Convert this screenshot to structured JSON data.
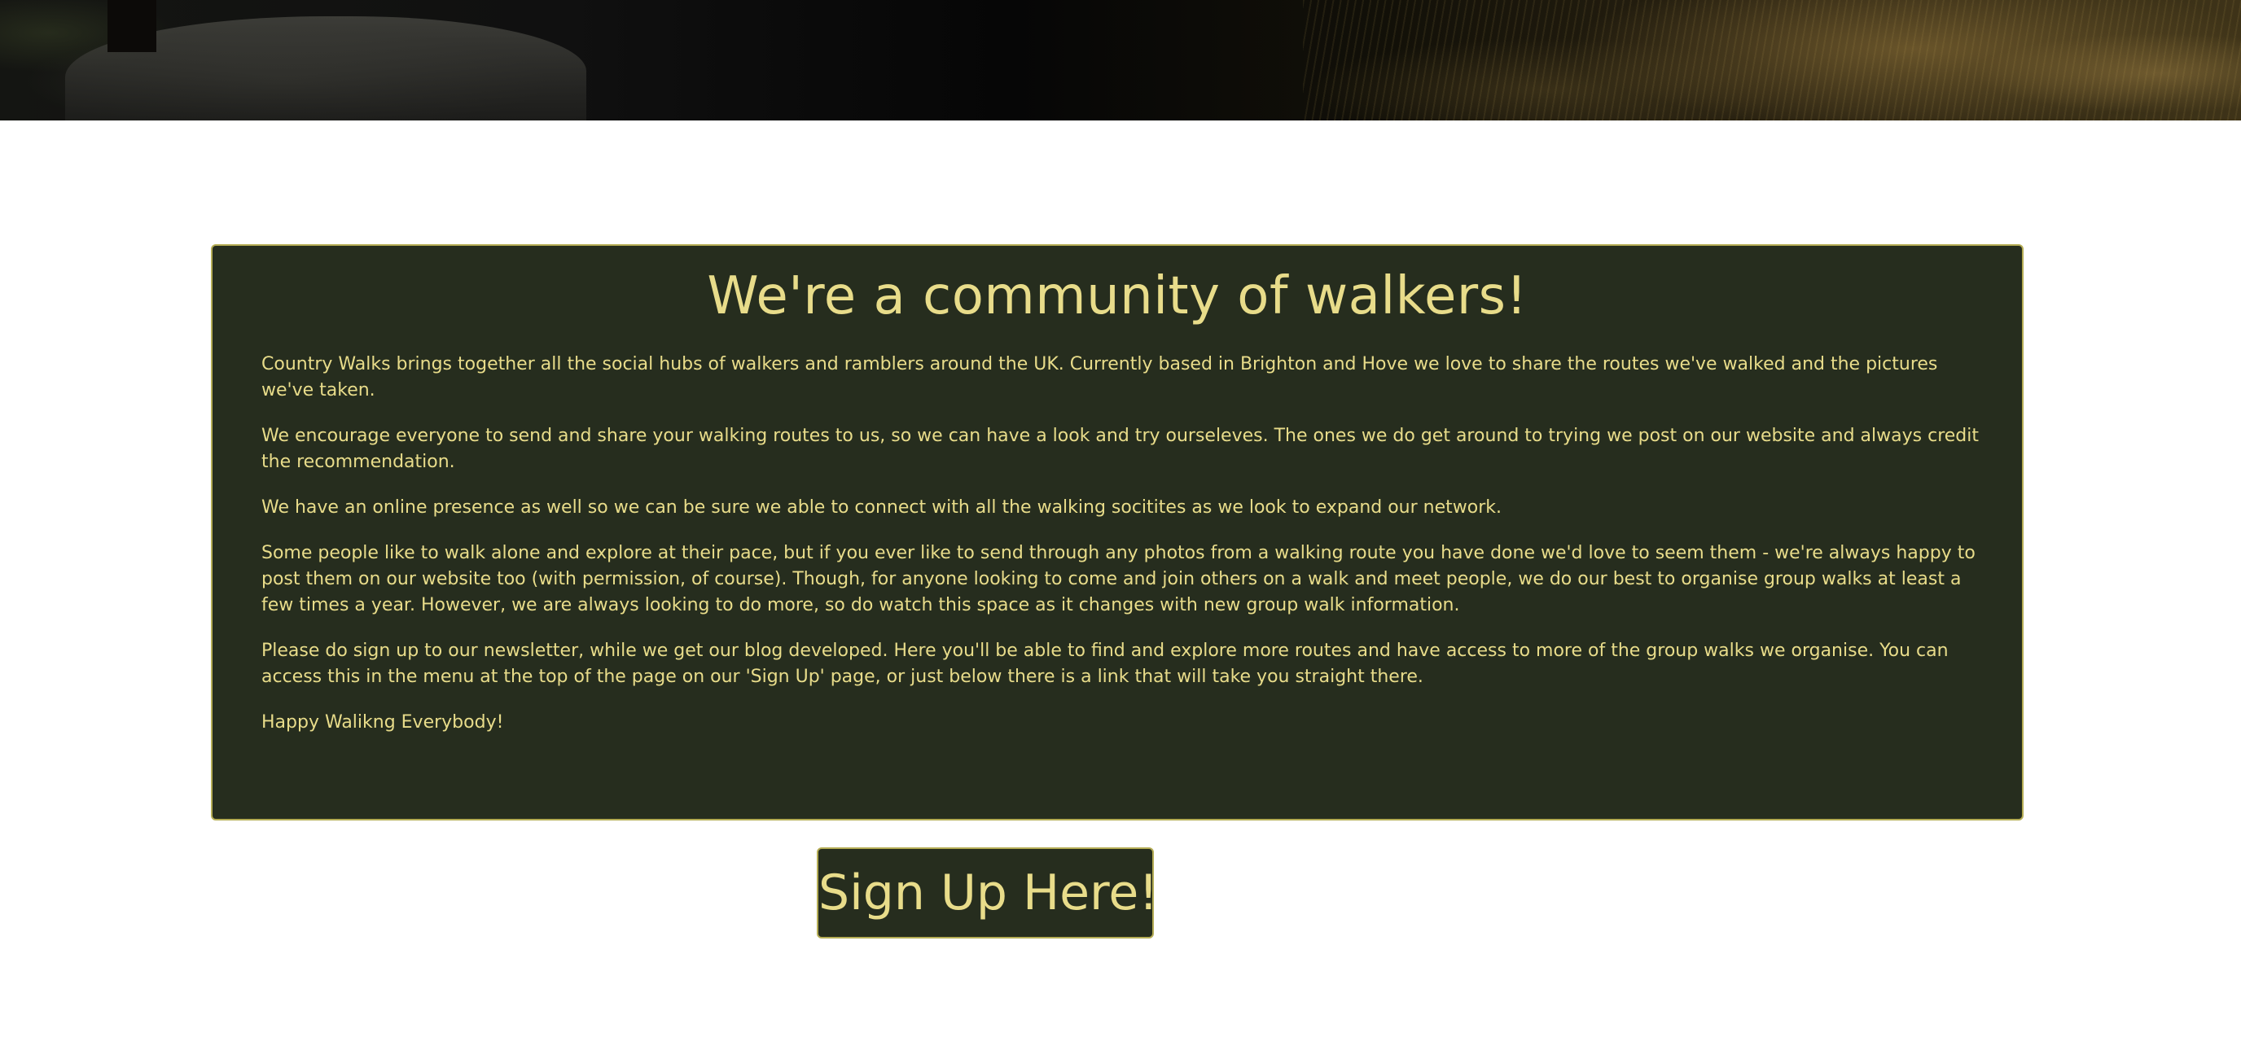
{
  "about": {
    "heading": "We're a community of walkers!",
    "paragraphs": [
      "Country Walks brings together all the social hubs of walkers and ramblers around the UK. Currently based in Brighton and Hove we love to share the routes we've walked and the pictures we've taken.",
      "We encourage everyone to send and share your walking routes to us, so we can have a look and try ourseleves. The ones we do get around to trying we post on our website and always credit the recommendation.",
      "We have an online presence as well so we can be sure we able to connect with all the walking socitites as we look to expand our network.",
      "Some people like to walk alone and explore at their pace, but if you ever like to send through any photos from a walking route you have done we'd love to seem them - we're always happy to post them on our website too (with permission, of course). Though, for anyone looking to come and join others on a walk and meet people, we do our best to organise group walks at least a few times a year. However, we are always looking to do more, so do watch this space as it changes with new group walk information.",
      "Please do sign up to our newsletter, while we get our blog developed. Here you'll be able to find and explore more routes and have access to more of the group walks we organise. You can access this in the menu at the top of the page on our 'Sign Up' page, or just below there is a link that will take you straight there.",
      "Happy Walikng Everybody!"
    ]
  },
  "signup_button": {
    "label": "Sign Up Here!"
  },
  "colors": {
    "card_background": "#262d1e",
    "card_border": "#b5ad55",
    "text": "#e8dc8a",
    "page_background": "#ffffff"
  }
}
